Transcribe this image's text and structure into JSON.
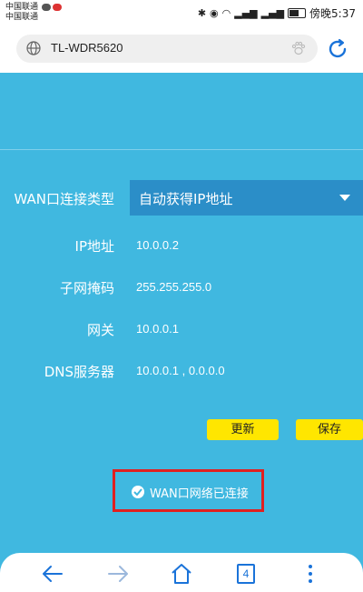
{
  "status_bar": {
    "carrier_1": "中国联通",
    "carrier_2": "中国联通",
    "clock": "傍晚5:37"
  },
  "browser": {
    "url": "TL-WDR5620",
    "tab_count": "4"
  },
  "form": {
    "wan_type_label": "WAN口连接类型",
    "wan_type_value": "自动获得IP地址",
    "ip_label": "IP地址",
    "ip_value": "10.0.0.2",
    "mask_label": "子网掩码",
    "mask_value": "255.255.255.0",
    "gateway_label": "网关",
    "gateway_value": "10.0.0.1",
    "dns_label": "DNS服务器",
    "dns_value": "10.0.0.1 , 0.0.0.0",
    "refresh_label": "更新",
    "save_label": "保存",
    "status_text": "WAN口网络已连接"
  },
  "colors": {
    "background": "#40b8e0",
    "select_bg": "#2b8ec8",
    "button_yellow": "#ffe600",
    "highlight_red": "#e02020",
    "nav_blue": "#1a73d9"
  }
}
